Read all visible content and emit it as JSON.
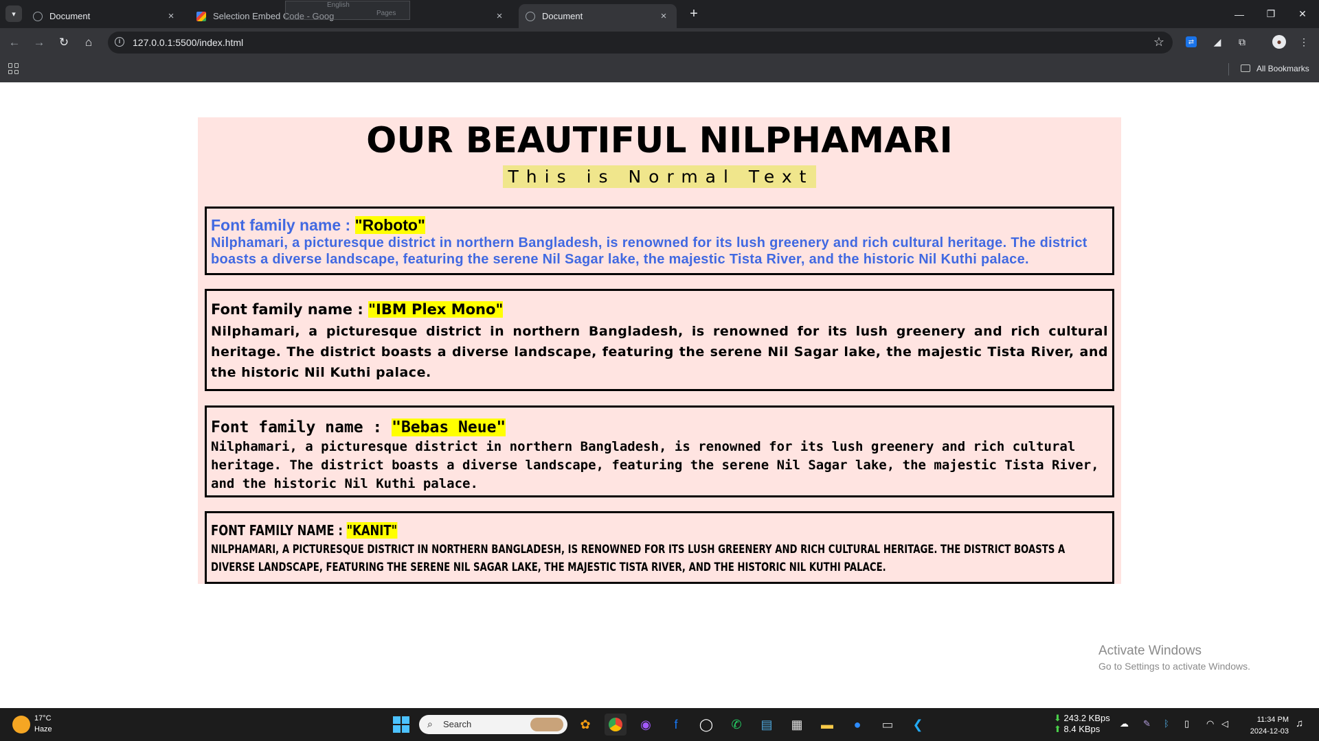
{
  "browser": {
    "tabs": [
      {
        "title": "Document",
        "close": "×"
      },
      {
        "title": "Selection Embed Code - Goog",
        "close": "×"
      },
      {
        "title": "Document",
        "close": "×"
      }
    ],
    "ghost_tab": {
      "left_text": "English",
      "right_text": "Pages"
    },
    "new_tab": "+",
    "window_controls": {
      "minimize": "—",
      "restore": "❐",
      "close": "✕"
    },
    "url": "127.0.0.1:5500/index.html",
    "bookmarks_label": "All Bookmarks"
  },
  "page": {
    "title": "OUR BEAUTIFUL NILPHAMARI",
    "subtitle": "This is Normal Text",
    "sections": [
      {
        "heading_prefix": "Font family name : ",
        "font_name": "\"Roboto\"",
        "paragraph": "Nilphamari, a picturesque district in northern Bangladesh, is renowned for its lush greenery and rich cultural heritage. The district boasts a diverse landscape, featuring the serene Nil Sagar lake, the majestic Tista River, and the historic Nil Kuthi palace."
      },
      {
        "heading_prefix": "Font family name : ",
        "font_name": "\"IBM Plex Mono\"",
        "paragraph": "Nilphamari, a picturesque district in northern Bangladesh, is renowned for its lush greenery and rich cultural heritage. The district boasts a diverse landscape, featuring the serene Nil Sagar lake, the majestic Tista River, and the historic Nil Kuthi palace."
      },
      {
        "heading_prefix": "Font family name : ",
        "font_name": "\"Bebas Neue\"",
        "paragraph": "Nilphamari, a picturesque district in northern Bangladesh, is renowned for its lush greenery and rich cultural heritage. The district boasts a diverse landscape, featuring the serene Nil Sagar lake, the majestic Tista River, and the historic Nil Kuthi palace."
      },
      {
        "heading_prefix": "Font family name : ",
        "font_name": "\"Kanit\"",
        "paragraph": "Nilphamari, a picturesque district in northern Bangladesh, is renowned for its lush greenery and rich cultural heritage. The district boasts a diverse landscape, featuring the serene Nil Sagar lake, the majestic Tista River, and the historic Nil Kuthi palace."
      }
    ]
  },
  "watermark": {
    "line1": "Activate Windows",
    "line2": "Go to Settings to activate Windows."
  },
  "taskbar": {
    "weather_temp": "17°C",
    "weather_condition": "Haze",
    "search_label": "Search",
    "net_down": "243.2 KBps",
    "net_up": "8.4 KBps",
    "time": "11:34 PM",
    "date": "2024-12-03"
  },
  "colors": {
    "page_background": "#ffe4e1",
    "highlight": "#ffff00",
    "subtitle_highlight": "#f0e68c",
    "roboto_text": "#4169e1"
  }
}
